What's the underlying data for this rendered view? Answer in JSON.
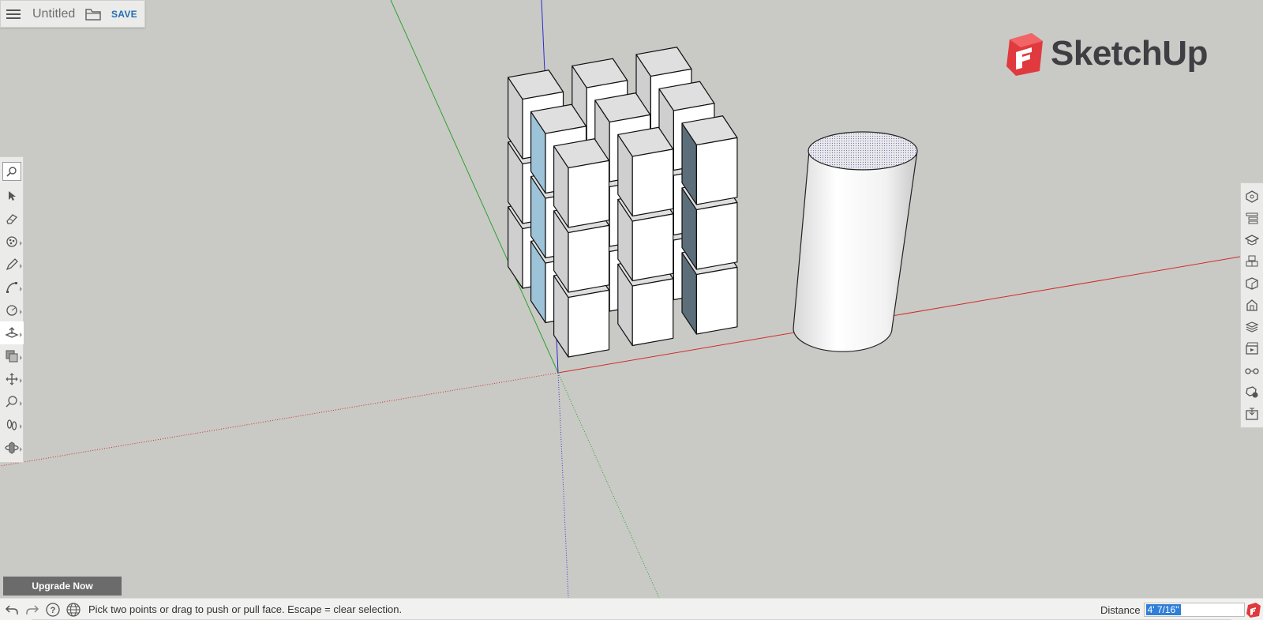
{
  "app": {
    "title": "Untitled",
    "save_label": "SAVE",
    "logo_text": "SketchUp",
    "brand_color": "#e03a3e"
  },
  "left_toolbar": {
    "tools": [
      {
        "name": "search-tool",
        "icon": "search-icon",
        "active": false
      },
      {
        "name": "select-tool",
        "icon": "arrow-cursor-icon",
        "active": false
      },
      {
        "name": "eraser-tool",
        "icon": "eraser-icon",
        "active": false
      },
      {
        "name": "paint-bucket-tool",
        "icon": "paint-icon",
        "active": false
      },
      {
        "name": "pencil-tool",
        "icon": "pencil-icon",
        "active": false
      },
      {
        "name": "arc-tool",
        "icon": "arc-icon",
        "active": false
      },
      {
        "name": "circle-tool",
        "icon": "circle-icon",
        "active": false
      },
      {
        "name": "push-pull-tool",
        "icon": "push-pull-icon",
        "active": true
      },
      {
        "name": "offset-tool",
        "icon": "offset-icon",
        "active": false
      },
      {
        "name": "move-tool",
        "icon": "move-icon",
        "active": false
      },
      {
        "name": "tape-measure-tool",
        "icon": "tape-measure-icon",
        "active": false
      },
      {
        "name": "walk-tool",
        "icon": "footsteps-icon",
        "active": false
      },
      {
        "name": "orbit-tool",
        "icon": "orbit-icon",
        "active": false
      }
    ]
  },
  "right_toolbar": {
    "panels": [
      "entity-info-icon",
      "outliner-icon",
      "instructor-icon",
      "components-icon",
      "materials-icon",
      "3d-warehouse-icon",
      "layers-icon",
      "scenes-icon",
      "display-icon",
      "model-info-icon",
      "export-icon"
    ]
  },
  "upgrade": {
    "label": "Upgrade Now"
  },
  "status": {
    "message": "Pick two points or drag to push or pull face. Escape = clear selection.",
    "measure_label": "Distance",
    "measure_value": "4' 7/16\""
  },
  "colors": {
    "viewport_bg": "#c9cac5",
    "axis_red": "#d22b2b",
    "axis_green": "#2da12d",
    "axis_blue": "#2b2bd2",
    "face_top": "#dfdfdf",
    "face_front": "#ffffff",
    "face_side": "#cfcfcf",
    "face_dark": "#5d6e7b",
    "face_selected": "#9cc3d8"
  }
}
